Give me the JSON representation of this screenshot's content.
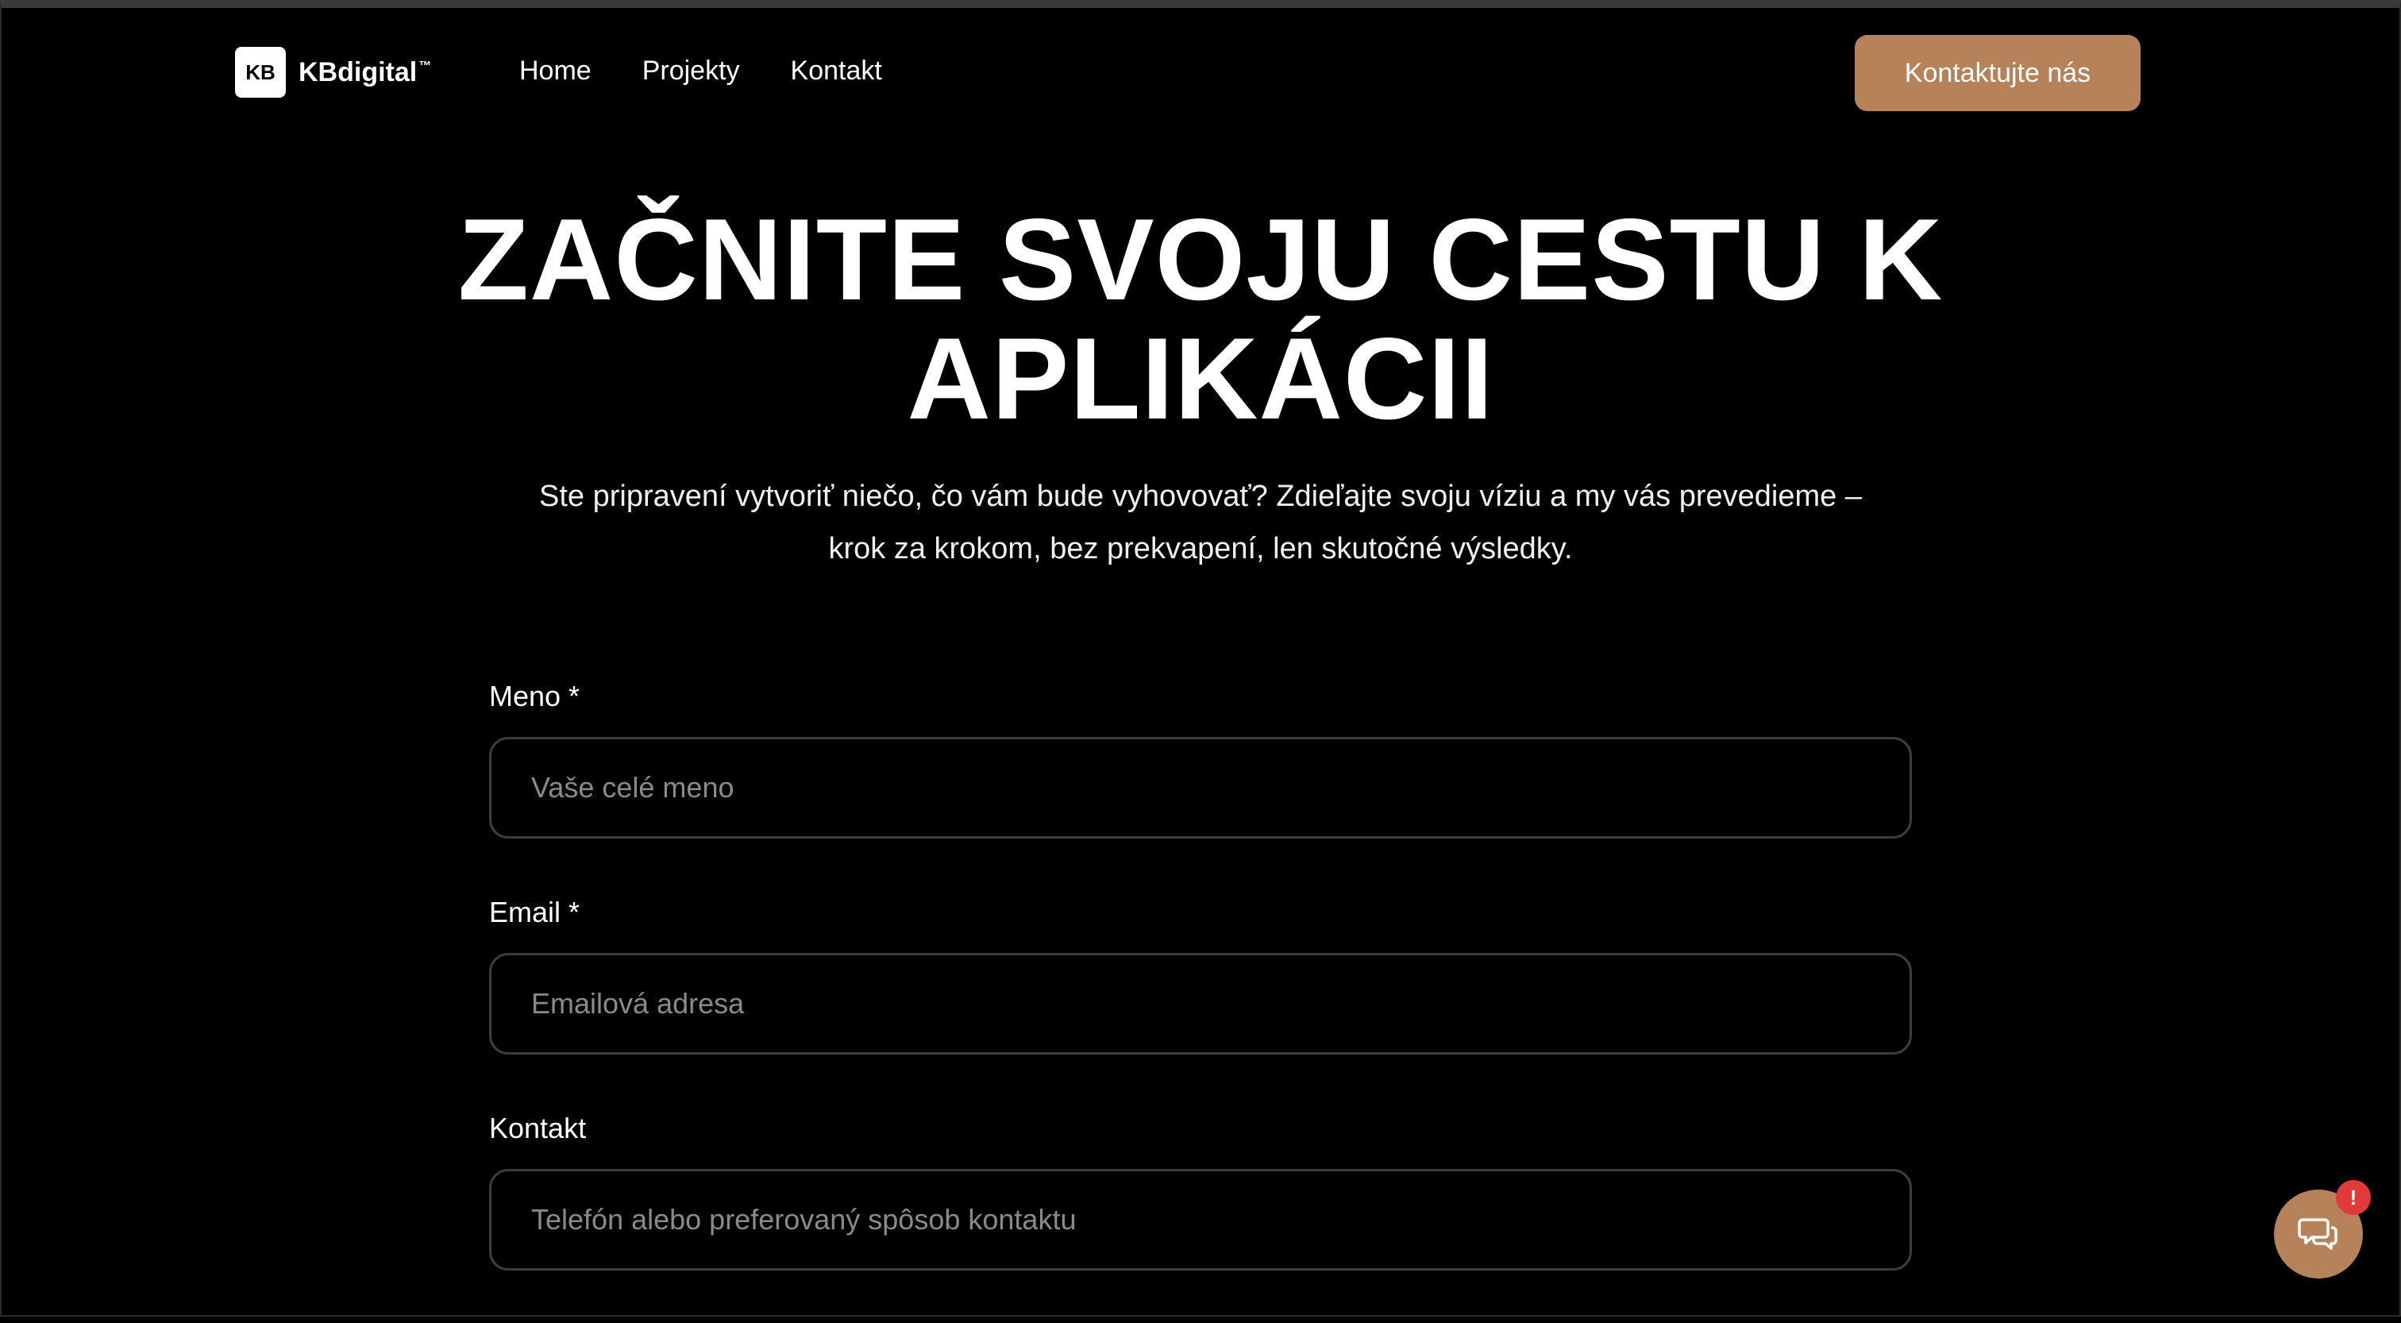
{
  "header": {
    "logo_mark": "KB",
    "logo_text": "KBdigital",
    "logo_tm": "™",
    "nav": [
      "Home",
      "Projekty",
      "Kontakt"
    ],
    "cta_label": "Kontaktujte nás"
  },
  "hero": {
    "title_line1": "ZAČNITE SVOJU CESTU K",
    "title_line2": "APLIKÁCII",
    "subtitle_line1": "Ste pripravení vytvoriť niečo, čo vám bude vyhovovať? Zdieľajte svoju víziu a my vás prevedieme –",
    "subtitle_line2": "krok za krokom, bez prekvapení, len skutočné výsledky."
  },
  "form": {
    "name": {
      "label": "Meno *",
      "placeholder": "Vaše celé meno"
    },
    "email": {
      "label": "Email *",
      "placeholder": "Emailová adresa"
    },
    "contact": {
      "label": "Kontakt",
      "placeholder": "Telefón alebo preferovaný spôsob kontaktu"
    }
  },
  "chat": {
    "badge": "!",
    "icon": "chat-bubbles-icon"
  },
  "colors": {
    "accent": "#b5825a",
    "badge": "#e23a3a",
    "background": "#000000",
    "input_border": "#3d3d3d"
  }
}
